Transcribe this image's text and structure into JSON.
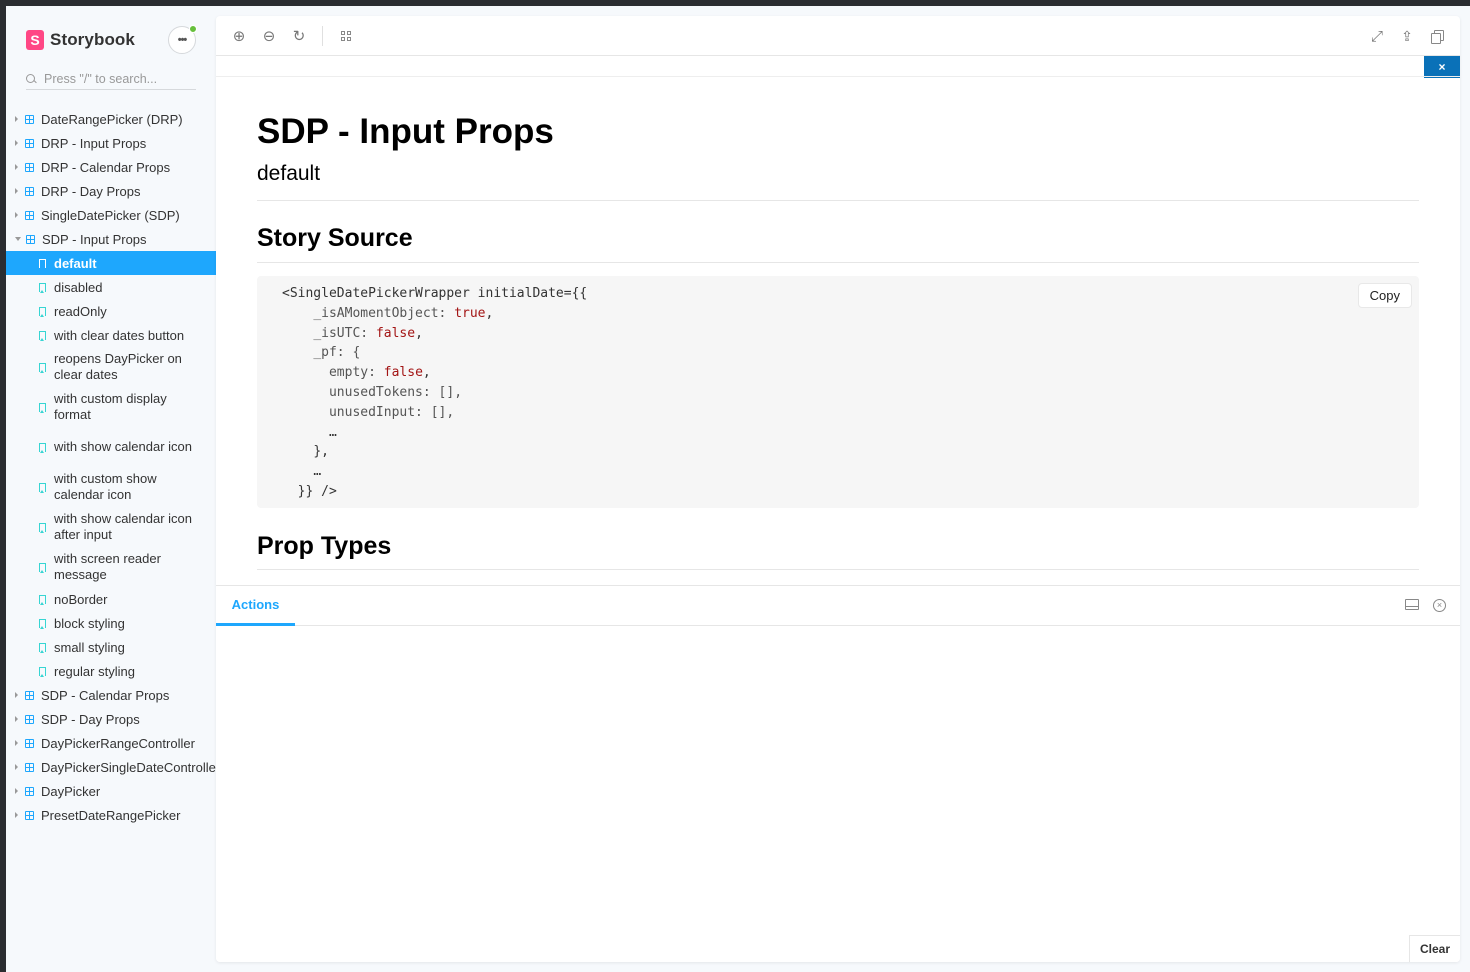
{
  "sidebar": {
    "brand": "Storybook",
    "logo_letter": "S",
    "menu_label": "•••",
    "search_placeholder": "Press \"/\" to search...",
    "groups_before": [
      {
        "label": "DateRangePicker (DRP)"
      },
      {
        "label": "DRP - Input Props"
      },
      {
        "label": "DRP - Calendar Props"
      },
      {
        "label": "DRP - Day Props"
      },
      {
        "label": "SingleDatePicker (SDP)"
      }
    ],
    "open_group": {
      "label": "SDP - Input Props"
    },
    "stories": [
      {
        "label": "default",
        "selected": true
      },
      {
        "label": "disabled"
      },
      {
        "label": "readOnly"
      },
      {
        "label": "with clear dates button"
      },
      {
        "label": "reopens DayPicker on clear dates"
      },
      {
        "label": "with custom display format"
      },
      {
        "label": "with show calendar icon"
      },
      {
        "label": "with custom show calendar icon"
      },
      {
        "label": "with show calendar icon after input"
      },
      {
        "label": "with screen reader message"
      },
      {
        "label": "noBorder"
      },
      {
        "label": "block styling"
      },
      {
        "label": "small styling"
      },
      {
        "label": "regular styling"
      }
    ],
    "groups_after": [
      {
        "label": "SDP - Calendar Props"
      },
      {
        "label": "SDP - Day Props"
      },
      {
        "label": "DayPickerRangeController"
      },
      {
        "label": "DayPickerSingleDateController"
      },
      {
        "label": "DayPicker"
      },
      {
        "label": "PresetDateRangePicker"
      }
    ]
  },
  "toolbar": {
    "left_icons": [
      "zoom-in-icon",
      "zoom-out-icon",
      "zoom-reset-icon",
      "grid-icon"
    ],
    "right_icons": [
      "fullscreen-icon",
      "share-icon",
      "copy-link-icon"
    ]
  },
  "docs": {
    "close_label": "×",
    "title": "SDP - Input Props",
    "subtitle": "default",
    "story_source_heading": "Story Source",
    "prop_types_heading": "Prop Types",
    "copy_label": "Copy",
    "code": {
      "l1_tag": "<SingleDatePickerWrapper",
      "l1_attr": " initialDate={{",
      "l2_key": "_isAMomentObject: ",
      "l2_val": "true",
      "l3_key": "_isUTC: ",
      "l3_val": "false",
      "l4": "_pf: {",
      "l5_key": "empty: ",
      "l5_val": "false",
      "l6": "unusedTokens: [],",
      "l7": "unusedInput: [],",
      "l8": "…",
      "l9": "},",
      "l10": "…",
      "l11": "}} />"
    }
  },
  "addons": {
    "tab_label": "Actions",
    "clear_label": "Clear"
  },
  "colors": {
    "accent": "#1ea7fd",
    "brand": "#ff4785",
    "story_icon": "#37d5d3",
    "close_button": "#0a71b8",
    "status_dot": "#66bf3c",
    "code_bool": "#a31515"
  }
}
